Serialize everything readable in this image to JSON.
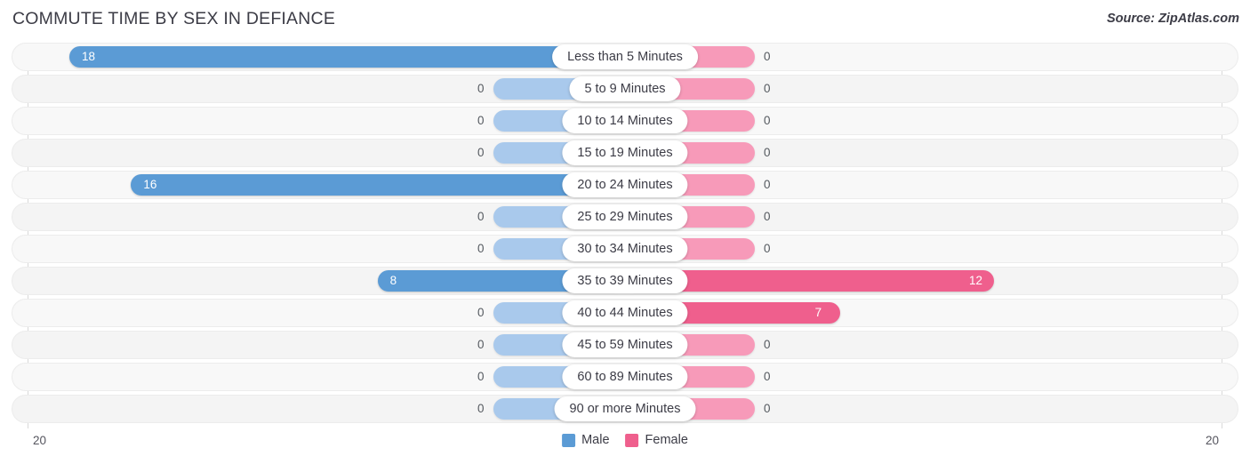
{
  "header": {
    "title": "COMMUTE TIME BY SEX IN DEFIANCE",
    "source": "Source: ZipAtlas.com"
  },
  "legend": {
    "male_label": "Male",
    "female_label": "Female",
    "male_color": "#5b9bd5",
    "female_color": "#ef5f8d"
  },
  "axis": {
    "left_tick": "20",
    "right_tick": "20"
  },
  "chart_data": {
    "type": "bar",
    "title": "COMMUTE TIME BY SEX IN DEFIANCE",
    "subtitle": "",
    "orientation": "horizontal-diverging",
    "xlabel": "",
    "ylabel": "",
    "xlim": [
      20,
      20
    ],
    "axis_max": 20,
    "grid": false,
    "legend_position": "bottom-center",
    "categories": [
      "Less than 5 Minutes",
      "5 to 9 Minutes",
      "10 to 14 Minutes",
      "15 to 19 Minutes",
      "20 to 24 Minutes",
      "25 to 29 Minutes",
      "30 to 34 Minutes",
      "35 to 39 Minutes",
      "40 to 44 Minutes",
      "45 to 59 Minutes",
      "60 to 89 Minutes",
      "90 or more Minutes"
    ],
    "series": [
      {
        "name": "Male",
        "values": [
          18,
          0,
          0,
          0,
          16,
          0,
          0,
          8,
          0,
          0,
          0,
          0
        ]
      },
      {
        "name": "Female",
        "values": [
          0,
          0,
          0,
          0,
          0,
          0,
          0,
          12,
          7,
          0,
          0,
          0
        ]
      }
    ],
    "rows": [
      {
        "label": "Less than 5 Minutes",
        "male": "18",
        "female": "0"
      },
      {
        "label": "5 to 9 Minutes",
        "male": "0",
        "female": "0"
      },
      {
        "label": "10 to 14 Minutes",
        "male": "0",
        "female": "0"
      },
      {
        "label": "15 to 19 Minutes",
        "male": "0",
        "female": "0"
      },
      {
        "label": "20 to 24 Minutes",
        "male": "16",
        "female": "0"
      },
      {
        "label": "25 to 29 Minutes",
        "male": "0",
        "female": "0"
      },
      {
        "label": "30 to 34 Minutes",
        "male": "0",
        "female": "0"
      },
      {
        "label": "35 to 39 Minutes",
        "male": "8",
        "female": "12"
      },
      {
        "label": "40 to 44 Minutes",
        "male": "0",
        "female": "7"
      },
      {
        "label": "45 to 59 Minutes",
        "male": "0",
        "female": "0"
      },
      {
        "label": "60 to 89 Minutes",
        "male": "0",
        "female": "0"
      },
      {
        "label": "90 or more Minutes",
        "male": "0",
        "female": "0"
      }
    ]
  }
}
